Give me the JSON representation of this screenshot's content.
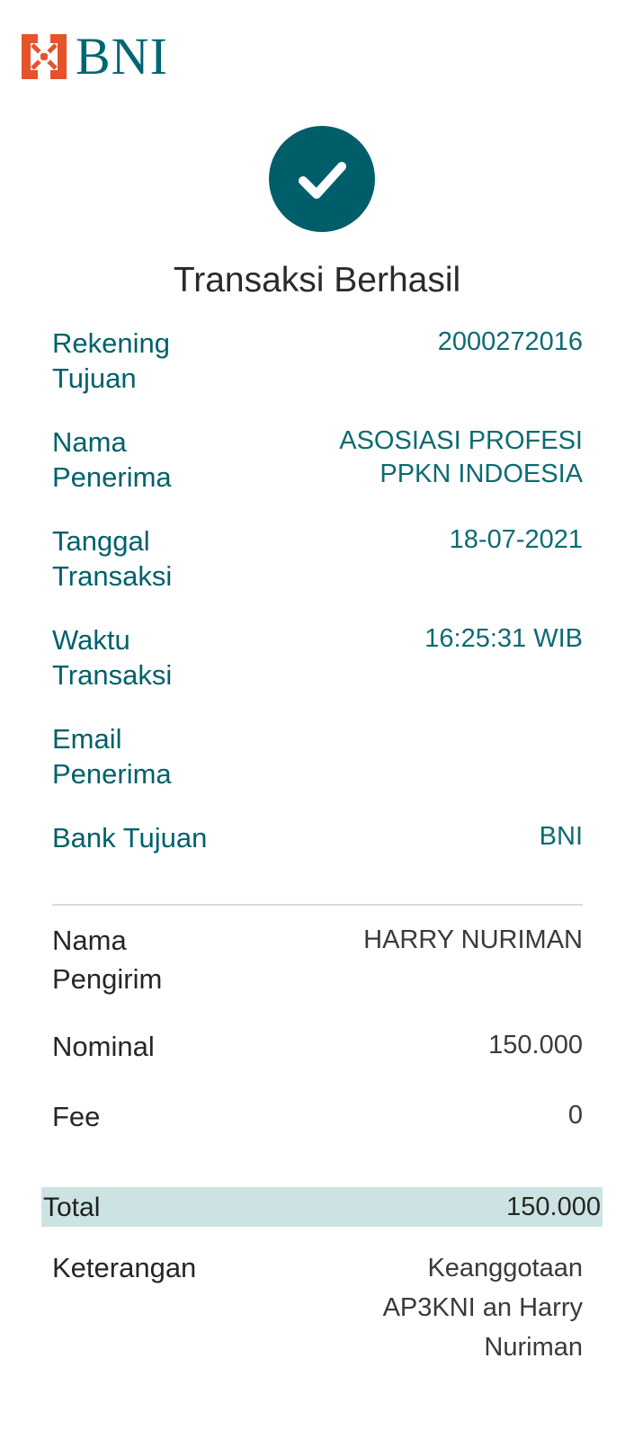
{
  "header": {
    "brand_name": "BNI",
    "brand_color": "#00666f",
    "brand_accent": "#e5532a"
  },
  "status": {
    "icon": "check-icon",
    "icon_bg": "#005e6a",
    "title": "Transaksi Berhasil"
  },
  "recipient": {
    "rekening_label_1": "Rekening",
    "rekening_label_2": "Tujuan",
    "rekening_value": "2000272016",
    "nama_label_1": "Nama",
    "nama_label_2": "Penerima",
    "nama_value_1": "ASOSIASI PROFESI",
    "nama_value_2": "PPKN INDOESIA",
    "tanggal_label_1": "Tanggal",
    "tanggal_label_2": "Transaksi",
    "tanggal_value": "18-07-2021",
    "waktu_label_1": "Waktu",
    "waktu_label_2": "Transaksi",
    "waktu_value": "16:25:31 WIB",
    "email_label_1": "Email",
    "email_label_2": "Penerima",
    "email_value": "",
    "bank_label": "Bank Tujuan",
    "bank_value": "BNI"
  },
  "sender": {
    "nama_label_1": "Nama",
    "nama_label_2": "Pengirim",
    "nama_value": "HARRY NURIMAN",
    "nominal_label": "Nominal",
    "nominal_value": "150.000",
    "fee_label": "Fee",
    "fee_value": "0",
    "total_label": "Total",
    "total_value": "150.000",
    "keterangan_label": "Keterangan",
    "keterangan_value_1": "Keanggotaan",
    "keterangan_value_2": "AP3KNI an Harry",
    "keterangan_value_3": "Nuriman"
  }
}
